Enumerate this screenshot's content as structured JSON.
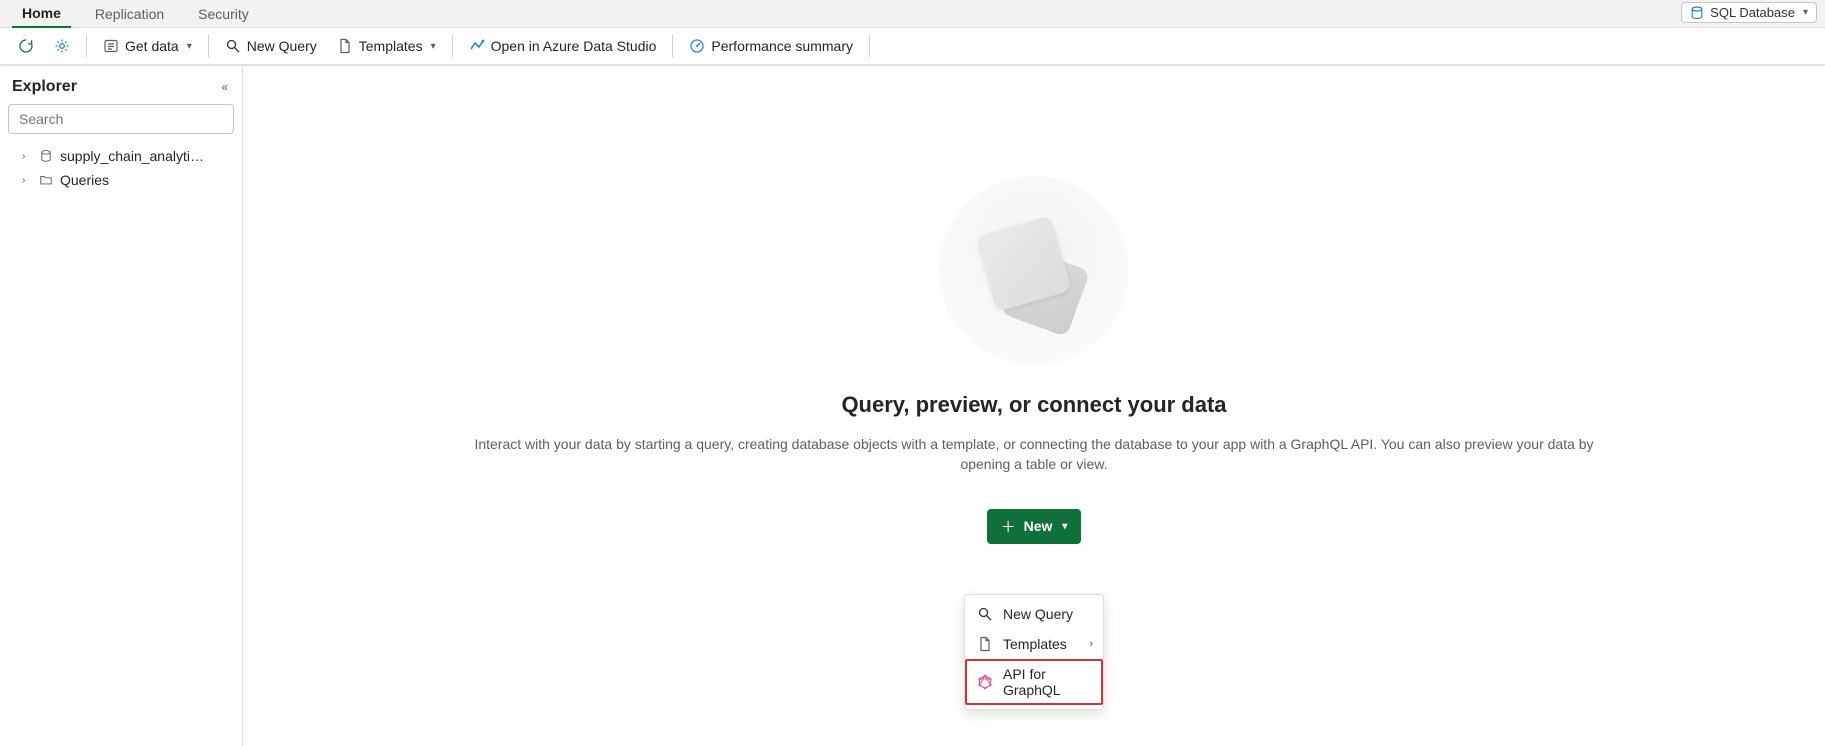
{
  "tabs": {
    "home": "Home",
    "replication": "Replication",
    "security": "Security"
  },
  "context_pill": {
    "label": "SQL Database"
  },
  "toolbar": {
    "get_data": "Get data",
    "new_query": "New Query",
    "templates": "Templates",
    "open_ads": "Open in Azure Data Studio",
    "perf_summary": "Performance summary"
  },
  "explorer": {
    "title": "Explorer",
    "search_placeholder": "Search",
    "tree": {
      "db_name": "supply_chain_analytics...",
      "queries": "Queries"
    }
  },
  "main": {
    "headline": "Query, preview, or connect your data",
    "subtext": "Interact with your data by starting a query, creating database objects with a template, or connecting the database to your app with a GraphQL API. You can also preview your data by opening a table or view.",
    "new_button": "New"
  },
  "dropdown": {
    "new_query": "New Query",
    "templates": "Templates",
    "api_graphql": "API for GraphQL"
  }
}
